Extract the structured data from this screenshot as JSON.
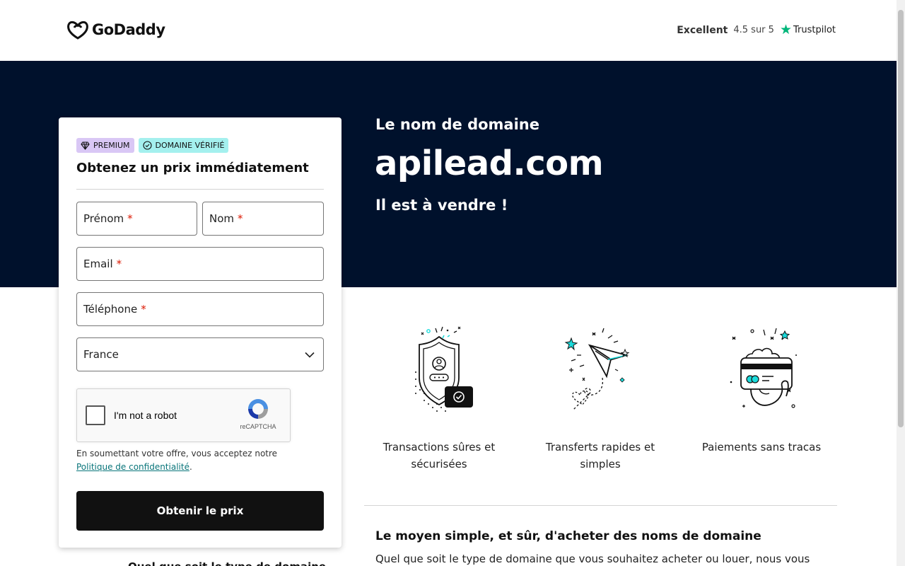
{
  "header": {
    "brand": "GoDaddy",
    "rating_label": "Excellent",
    "rating_value": "4.5 sur 5",
    "trustpilot": "Trustpilot"
  },
  "hero": {
    "subtitle": "Le nom de domaine",
    "domain": "apilead.com",
    "tagline": "Il est à vendre !"
  },
  "form": {
    "badge_premium": "PREMIUM",
    "badge_verified": "DOMAINE VÉRIFIÉ",
    "title": "Obtenez un prix immédiatement",
    "first_name_label": "Prénom",
    "last_name_label": "Nom",
    "email_label": "Email",
    "phone_label": "Téléphone",
    "required_mark": "*",
    "country_value": "France",
    "captcha_label": "I'm not a robot",
    "captcha_brand": "reCAPTCHA",
    "consent_text": "En soumettant votre offre, vous acceptez notre",
    "privacy_link": "Politique de confidentialité",
    "consent_end": ".",
    "submit_label": "Obtenir le prix",
    "below_card_text": "Quel que soit le type de domaine"
  },
  "features": [
    {
      "label": "Transactions sûres et sécurisées",
      "icon": "shield-icon"
    },
    {
      "label": "Transferts rapides et simples",
      "icon": "paper-plane-icon"
    },
    {
      "label": "Paiements sans tracas",
      "icon": "card-payment-icon"
    }
  ],
  "section": {
    "title": "Le moyen simple, et sûr, d'acheter des noms de domaine",
    "body": "Quel que soit le type de domaine que vous souhaitez acheter ou louer, nous vous"
  },
  "colors": {
    "hero_bg": "#00112c",
    "premium_badge": "#d9c7f5",
    "verified_badge": "#a4f0ee",
    "accent_teal": "#1bdbdb",
    "required": "#db1802",
    "trustpilot_green": "#00b67a"
  }
}
